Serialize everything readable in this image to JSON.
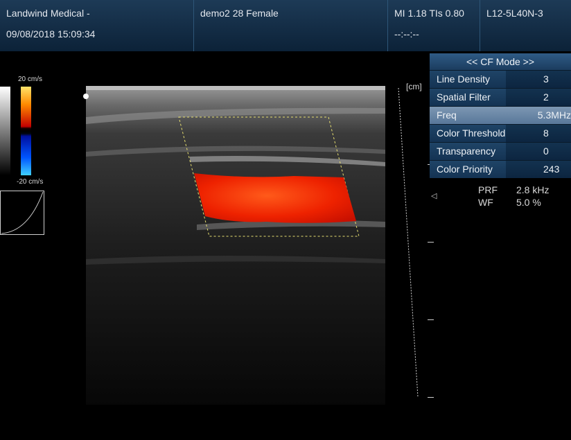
{
  "header": {
    "institution": "Landwind Medical -",
    "datetime": "09/08/2018 15:09:34",
    "patient": "demo2 28 Female",
    "indices": "MI 1.18 TIs 0.80",
    "indices_sub": "--:--:--",
    "probe": "L12-5L40N-3"
  },
  "scale": {
    "top_label": "20 cm/s",
    "bottom_label": "-20 cm/s"
  },
  "depth_unit": "[cm]",
  "menu": {
    "title": "<< CF Mode >>",
    "items": [
      {
        "label": "Line Density",
        "value": "3",
        "selected": false
      },
      {
        "label": "Spatial Filter",
        "value": "2",
        "selected": false
      },
      {
        "label": "Freq",
        "value": "5.3MHz",
        "selected": true
      },
      {
        "label": "Color Threshold",
        "value": "8",
        "selected": false
      },
      {
        "label": "Transparency",
        "value": "0",
        "selected": false
      },
      {
        "label": "Color Priority",
        "value": "243",
        "selected": false
      }
    ]
  },
  "params": [
    {
      "name": "PRF",
      "value": "2.8 kHz"
    },
    {
      "name": "WF",
      "value": "5.0 %"
    }
  ],
  "colors": {
    "header_bg": "#0c2238",
    "menu_selected": "#58779a",
    "flow_red": "#e01000"
  }
}
